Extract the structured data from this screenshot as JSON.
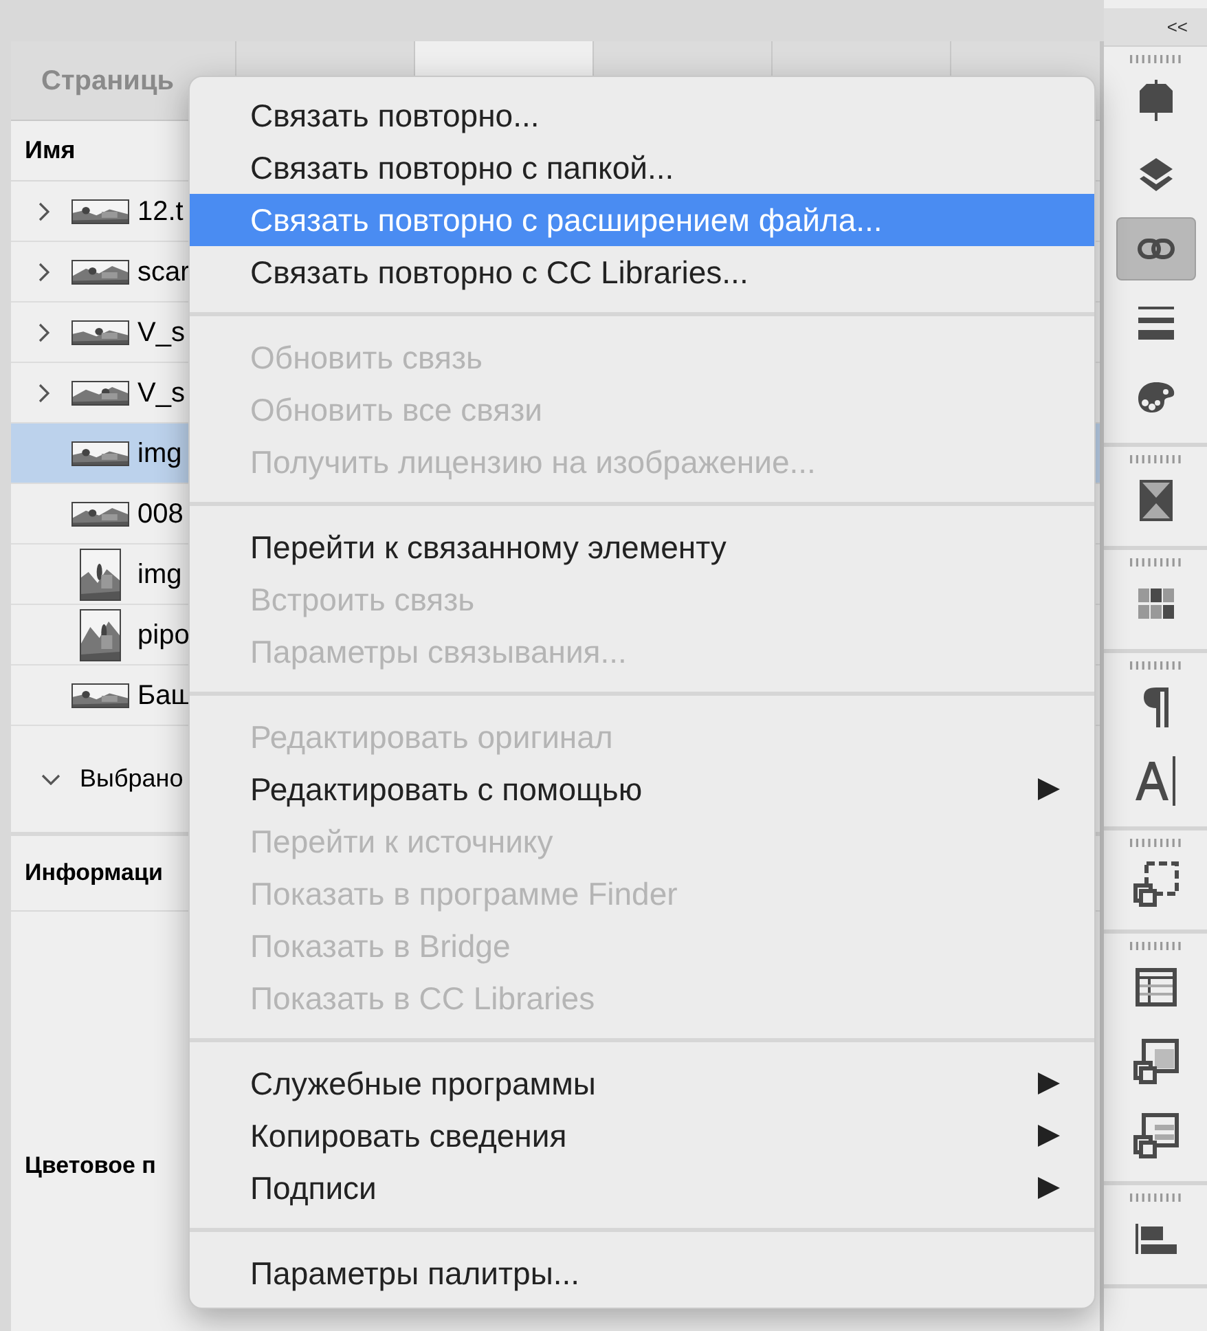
{
  "panel": {
    "tabs": [
      {
        "label": "Страниць",
        "selected": false
      },
      {
        "selected": false
      },
      {
        "selected": true
      },
      {
        "selected": false
      },
      {
        "selected": false
      }
    ],
    "column_header": "Имя",
    "rows": [
      {
        "name": "12.t",
        "kind": "group",
        "selected": false
      },
      {
        "name": "scar",
        "kind": "group",
        "selected": false
      },
      {
        "name": "V_s",
        "kind": "group",
        "selected": false
      },
      {
        "name": "V_s",
        "kind": "group",
        "selected": false
      },
      {
        "name": "img",
        "kind": "file",
        "selected": true
      },
      {
        "name": "008",
        "kind": "file",
        "selected": false
      },
      {
        "name": "img",
        "kind": "file",
        "selected": false
      },
      {
        "name": "pipo",
        "kind": "file",
        "selected": false
      },
      {
        "name": "Баш",
        "kind": "file",
        "selected": false
      }
    ],
    "selected_section": {
      "label": "Выбрано",
      "expanded": true
    },
    "info_title": "Информаци",
    "color_label": "Цветовое п"
  },
  "menu": [
    [
      {
        "label": "Связать повторно...",
        "disabled": false,
        "selected": false,
        "submenu": false
      },
      {
        "label": "Связать повторно с папкой...",
        "disabled": false,
        "selected": false,
        "submenu": false
      },
      {
        "label": "Связать повторно с расширением файла...",
        "disabled": false,
        "selected": true,
        "submenu": false
      },
      {
        "label": "Связать повторно с CC Libraries...",
        "disabled": false,
        "selected": false,
        "submenu": false
      }
    ],
    [
      {
        "label": "Обновить связь",
        "disabled": true,
        "selected": false,
        "submenu": false
      },
      {
        "label": "Обновить все связи",
        "disabled": true,
        "selected": false,
        "submenu": false
      },
      {
        "label": "Получить лицензию на изображение...",
        "disabled": true,
        "selected": false,
        "submenu": false
      }
    ],
    [
      {
        "label": "Перейти к связанному элементу",
        "disabled": false,
        "selected": false,
        "submenu": false
      },
      {
        "label": "Встроить связь",
        "disabled": true,
        "selected": false,
        "submenu": false
      },
      {
        "label": "Параметры связывания...",
        "disabled": true,
        "selected": false,
        "submenu": false
      }
    ],
    [
      {
        "label": "Редактировать оригинал",
        "disabled": true,
        "selected": false,
        "submenu": false
      },
      {
        "label": "Редактировать с помощью",
        "disabled": false,
        "selected": false,
        "submenu": true
      },
      {
        "label": "Перейти к источнику",
        "disabled": true,
        "selected": false,
        "submenu": false
      },
      {
        "label": "Показать в программе Finder",
        "disabled": true,
        "selected": false,
        "submenu": false
      },
      {
        "label": "Показать в Bridge",
        "disabled": true,
        "selected": false,
        "submenu": false
      },
      {
        "label": "Показать в CC Libraries",
        "disabled": true,
        "selected": false,
        "submenu": false
      }
    ],
    [
      {
        "label": "Служебные программы",
        "disabled": false,
        "selected": false,
        "submenu": true
      },
      {
        "label": "Копировать сведения",
        "disabled": false,
        "selected": false,
        "submenu": true
      },
      {
        "label": "Подписи",
        "disabled": false,
        "selected": false,
        "submenu": true
      }
    ],
    [
      {
        "label": "Параметры палитры...",
        "disabled": false,
        "selected": false,
        "submenu": false
      }
    ]
  ],
  "toolbar": {
    "collapse": "<<",
    "groups": [
      [
        {
          "kind": "pages",
          "selected": false
        },
        {
          "kind": "layers",
          "selected": false
        },
        {
          "kind": "links",
          "selected": true
        },
        {
          "kind": "stroke",
          "selected": false
        },
        {
          "kind": "swatches",
          "selected": false
        }
      ],
      [
        {
          "kind": "gradient",
          "selected": false
        }
      ],
      [
        {
          "kind": "grid",
          "selected": false
        }
      ],
      [
        {
          "kind": "paragraph",
          "selected": false
        },
        {
          "kind": "character",
          "selected": false
        }
      ],
      [
        {
          "kind": "frame",
          "selected": false
        }
      ],
      [
        {
          "kind": "table",
          "selected": false
        },
        {
          "kind": "cellstyle",
          "selected": false
        },
        {
          "kind": "tablestyle",
          "selected": false
        }
      ],
      [
        {
          "kind": "align",
          "selected": false
        }
      ]
    ]
  }
}
